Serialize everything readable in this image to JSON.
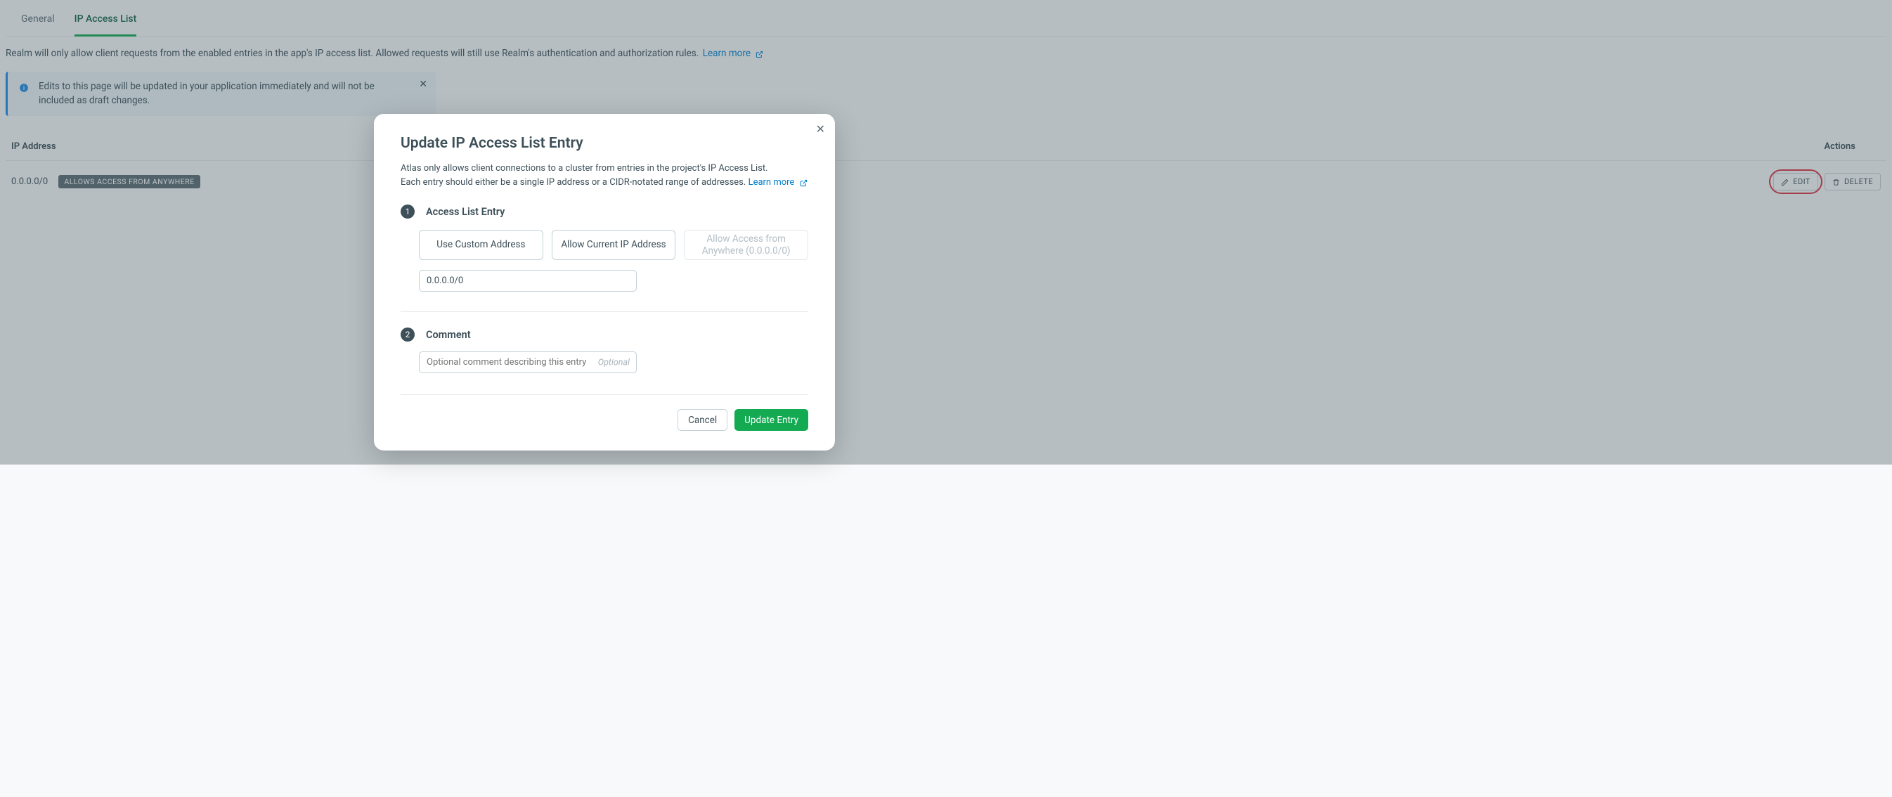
{
  "tabs": {
    "general": "General",
    "ip_access": "IP Access List"
  },
  "helper_text": "Realm will only allow client requests from the enabled entries in the app's IP access list. Allowed requests will still use Realm's authentication and authorization rules.",
  "learn_more": "Learn more",
  "notice": "Edits to this page will be updated in your application immediately and will not be included as draft changes.",
  "table": {
    "col_ip": "IP Address",
    "col_actions": "Actions",
    "row_ip": "0.0.0.0/0",
    "row_badge": "ALLOWS ACCESS FROM ANYWHERE",
    "edit": "EDIT",
    "delete": "DELETE"
  },
  "modal": {
    "title": "Update IP Access List Entry",
    "desc_line1": "Atlas only allows client connections to a cluster from entries in the project's IP Access List.",
    "desc_line2": "Each entry should either be a single IP address or a CIDR-notated range of addresses.",
    "learn_more": "Learn more",
    "step1_num": "1",
    "step1_label": "Access List Entry",
    "btn_custom": "Use Custom Address",
    "btn_current": "Allow Current IP Address",
    "btn_anywhere": "Allow Access from Anywhere (0.0.0.0/0)",
    "ip_value": "0.0.0.0/0",
    "step2_num": "2",
    "step2_label": "Comment",
    "comment_placeholder": "Optional comment describing this entry",
    "comment_hint": "Optional",
    "cancel": "Cancel",
    "update": "Update Entry"
  }
}
